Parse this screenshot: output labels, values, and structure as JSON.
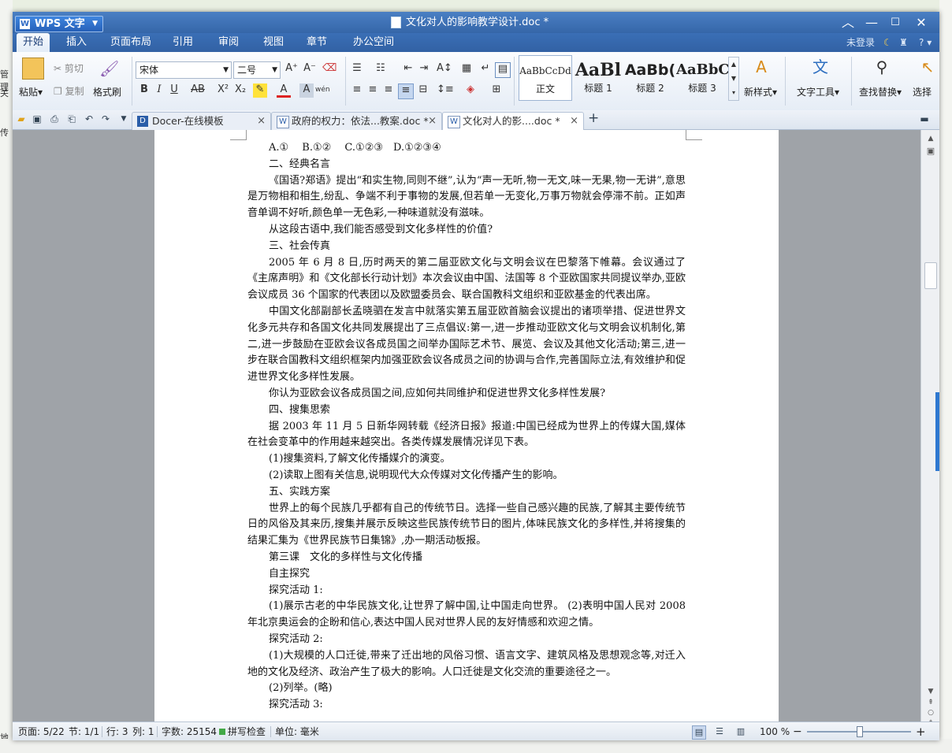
{
  "window": {
    "app_name": "WPS 文字",
    "title": "文化对人的影响教学设计.doc *"
  },
  "desktop": {
    "left_labels": [
      "管理",
      "关",
      "传",
      "地"
    ]
  },
  "menu": {
    "tabs": [
      "开始",
      "插入",
      "页面布局",
      "引用",
      "审阅",
      "视图",
      "章节",
      "办公空间"
    ],
    "login": "未登录",
    "help": "?"
  },
  "ribbon": {
    "paste": "粘贴",
    "cut": "剪切",
    "copy": "复制",
    "format_painter": "格式刷",
    "font_name": "宋体",
    "font_size": "二号",
    "styles": [
      {
        "sample": "AaBbCcDd",
        "name": "正文"
      },
      {
        "sample": "AaBl",
        "name": "标题 1"
      },
      {
        "sample": "AaBb(",
        "name": "标题 2"
      },
      {
        "sample": "AaBbC",
        "name": "标题 3"
      }
    ],
    "new_style": "新样式",
    "text_tools": "文字工具",
    "find_replace": "查找替换",
    "select": "选择"
  },
  "doc_tabs": [
    {
      "label": "Docer-在线模板",
      "close": "×"
    },
    {
      "label": "政府的权力：依法...教案.doc *",
      "close": "×"
    },
    {
      "label": "文化对人的影....doc *",
      "close": "×"
    }
  ],
  "document": {
    "paragraphs": [
      {
        "text": "A.①　 B.①②　 C.①②③　D.①②③④",
        "indent": true
      },
      {
        "text": "二、经典名言",
        "indent": true
      },
      {
        "text": "《国语?郑语》提出“和实生物,同则不继”,认为“声一无听,物一无文,味一无果,物一无讲”,意思是万物相和相生,纷乱、争端不利于事物的发展,但若单一无变化,万事万物就会停滞不前。正如声音单调不好听,颜色单一无色彩,一种味道就没有滋味。",
        "indent": true
      },
      {
        "text": "从这段古语中,我们能否感受到文化多样性的价值?",
        "indent": true
      },
      {
        "text": "三、社会传真",
        "indent": true
      },
      {
        "text": "2005 年 6 月 8 日,历时两天的第二届亚欧文化与文明会议在巴黎落下帷幕。会议通过了《主席声明》和《文化部长行动计划》本次会议由中国、法国等 8 个亚欧国家共同提议举办,亚欧会议成员 36 个国家的代表团以及欧盟委员会、联合国教科文组织和亚欧基金的代表出席。",
        "indent": true
      },
      {
        "text": "中国文化部副部长孟晓驷在发言中就落实第五届亚欧首脑会议提出的诸项举措、促进世界文化多元共存和各国文化共同发展提出了三点倡议:第一,进一步推动亚欧文化与文明会议机制化,第二,进一步鼓励在亚欧会议各成员国之间举办国际艺术节、展览、会议及其他文化活动;第三,进一步在联合国教科文组织框架内加强亚欧会议各成员之间的协调与合作,完善国际立法,有效维护和促进世界文化多样性发展。",
        "indent": true
      },
      {
        "text": "你认为亚欧会议各成员国之间,应如何共同维护和促进世界文化多样性发展?",
        "indent": true
      },
      {
        "text": "四、搜集思索",
        "indent": true
      },
      {
        "text": "据 2003 年 11 月 5 日新华网转载《经济日报》报道:中国已经成为世界上的传媒大国,媒体在社会变革中的作用越来越突出。各类传媒发展情况详见下表。",
        "indent": true
      },
      {
        "text": "(1)搜集资料,了解文化传播媒介的演变。",
        "indent": true
      },
      {
        "text": "(2)读取上图有关信息,说明现代大众传媒对文化传播产生的影响。",
        "indent": true
      },
      {
        "text": "五、实践方案",
        "indent": true
      },
      {
        "text": "世界上的每个民族几乎都有自己的传统节日。选择一些自己感兴趣的民族,了解其主要传统节日的风俗及其来历,搜集并展示反映这些民族传统节日的图片,体味民族文化的多样性,并将搜集的结果汇集为《世界民族节日集锦》,办一期活动板报。",
        "indent": true
      },
      {
        "text": "第三课　文化的多样性与文化传播",
        "indent": true
      },
      {
        "text": "自主探究",
        "indent": true
      },
      {
        "text": "探究活动 1:",
        "indent": true
      },
      {
        "text": "(1)展示古老的中华民族文化,让世界了解中国,让中国走向世界。 (2)表明中国人民对 2008 年北京奥运会的企盼和信心,表达中国人民对世界人民的友好情感和欢迎之情。",
        "indent": true
      },
      {
        "text": "探究活动 2:",
        "indent": true
      },
      {
        "text": "(1)大规模的人口迁徙,带来了迁出地的风俗习惯、语言文字、建筑风格及思想观念等,对迁入地的文化及经济、政治产生了极大的影响。人口迁徙是文化交流的重要途径之一。",
        "indent": true
      },
      {
        "text": "(2)列举。(略)",
        "indent": true
      },
      {
        "text": "探究活动 3:",
        "indent": true
      }
    ]
  },
  "status": {
    "page": "页面: 5/22",
    "section": "节: 1/1",
    "row": "行: 3",
    "col": "列: 1",
    "words": "字数: 25154",
    "spell": "拼写检查",
    "unit": "单位: 毫米",
    "zoom": "100 %",
    "zoom_level_pct": 100
  },
  "colors": {
    "title_bar": "#3a6fb6",
    "accent": "#2e78d0",
    "workspace": "#9fa3a8"
  }
}
